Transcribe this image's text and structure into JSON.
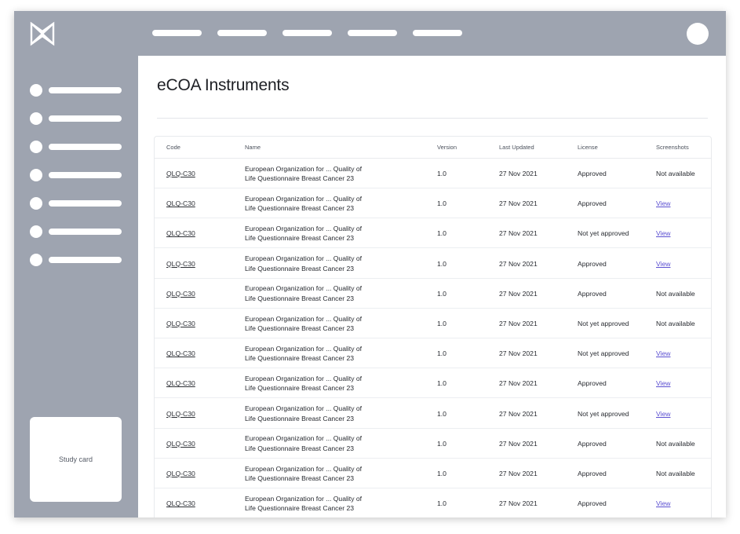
{
  "page": {
    "title": "eCOA Instruments"
  },
  "sidebar": {
    "study_card_label": "Study card"
  },
  "table": {
    "headers": [
      "Code",
      "Name",
      "Version",
      "Last Updated",
      "License",
      "Screenshots"
    ],
    "rows": [
      {
        "code": "QLQ-C30",
        "name": "European Organization for ... Quality of\nLife Questionnaire Breast Cancer 23",
        "version": "1.0",
        "updated": "27 Nov 2021",
        "license": "Approved",
        "screenshots": "Not available"
      },
      {
        "code": "QLQ-C30",
        "name": "European Organization for ... Quality of\nLife Questionnaire Breast Cancer 23",
        "version": "1.0",
        "updated": "27 Nov 2021",
        "license": "Approved",
        "screenshots": "View"
      },
      {
        "code": "QLQ-C30",
        "name": "European Organization for ... Quality of\nLife Questionnaire Breast Cancer 23",
        "version": "1.0",
        "updated": "27 Nov 2021",
        "license": "Not yet approved",
        "screenshots": "View"
      },
      {
        "code": "QLQ-C30",
        "name": "European Organization for ... Quality of\nLife Questionnaire Breast Cancer 23",
        "version": "1.0",
        "updated": "27 Nov 2021",
        "license": "Approved",
        "screenshots": "View"
      },
      {
        "code": "QLQ-C30",
        "name": "European Organization for ... Quality of\nLife Questionnaire Breast Cancer 23",
        "version": "1.0",
        "updated": "27 Nov 2021",
        "license": "Approved",
        "screenshots": "Not available"
      },
      {
        "code": "QLQ-C30",
        "name": "European Organization for ... Quality of\nLife Questionnaire Breast Cancer 23",
        "version": "1.0",
        "updated": "27 Nov 2021",
        "license": "Not yet approved",
        "screenshots": "Not available"
      },
      {
        "code": "QLQ-C30",
        "name": "European Organization for ... Quality of\nLife Questionnaire Breast Cancer 23",
        "version": "1.0",
        "updated": "27 Nov 2021",
        "license": "Not yet approved",
        "screenshots": "View"
      },
      {
        "code": "QLQ-C30",
        "name": "European Organization for ... Quality of\nLife Questionnaire Breast Cancer 23",
        "version": "1.0",
        "updated": "27 Nov 2021",
        "license": "Approved",
        "screenshots": "View"
      },
      {
        "code": "QLQ-C30",
        "name": "European Organization for ... Quality of\nLife Questionnaire Breast Cancer 23",
        "version": "1.0",
        "updated": "27 Nov 2021",
        "license": "Not yet approved",
        "screenshots": "View"
      },
      {
        "code": "QLQ-C30",
        "name": "European Organization for ... Quality of\nLife Questionnaire Breast Cancer 23",
        "version": "1.0",
        "updated": "27 Nov 2021",
        "license": "Approved",
        "screenshots": "Not available"
      },
      {
        "code": "QLQ-C30",
        "name": "European Organization for ... Quality of\nLife Questionnaire Breast Cancer 23",
        "version": "1.0",
        "updated": "27 Nov 2021",
        "license": "Approved",
        "screenshots": "Not available"
      },
      {
        "code": "QLQ-C30",
        "name": "European Organization for ... Quality of\nLife Questionnaire Breast Cancer 23",
        "version": "1.0",
        "updated": "27 Nov 2021",
        "license": "Approved",
        "screenshots": "View"
      }
    ]
  },
  "icons": {
    "logo": "brand-logo-icon"
  },
  "colors": {
    "chrome": "#9ea4b0",
    "link": "#5b4fd1",
    "text": "#26292f"
  }
}
